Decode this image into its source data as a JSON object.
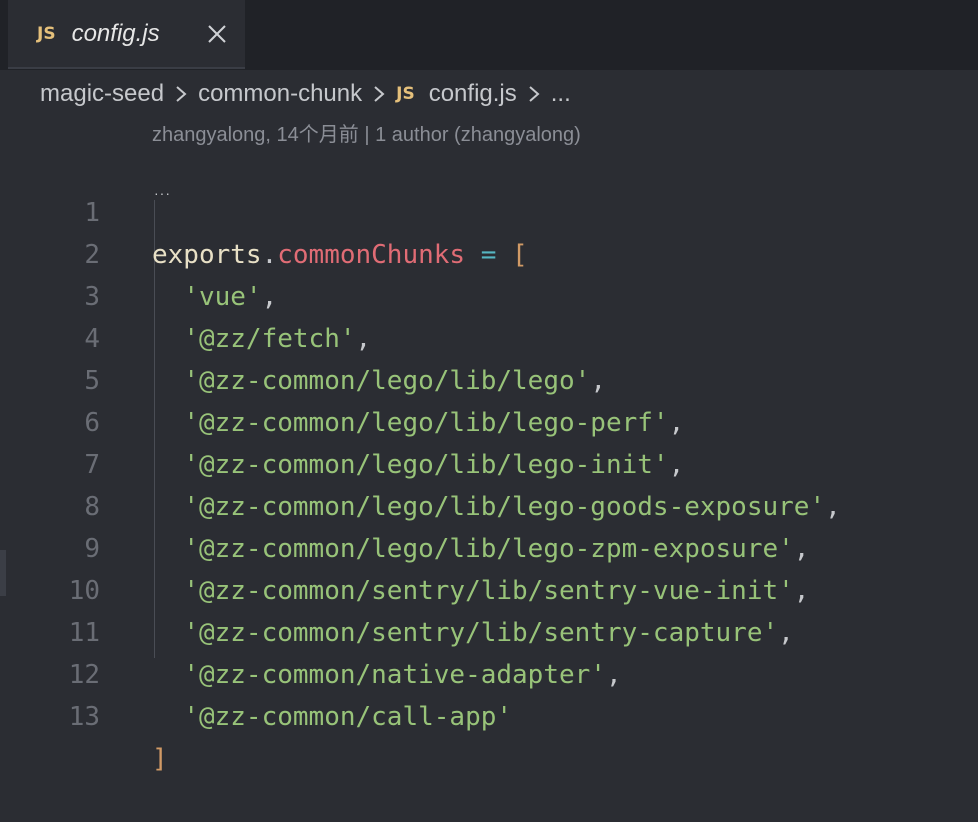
{
  "tab": {
    "badge": "JS",
    "title": "config.js"
  },
  "breadcrumb": {
    "items": [
      "magic-seed",
      "common-chunk"
    ],
    "file_badge": "JS",
    "file": "config.js",
    "more": "..."
  },
  "blame": "zhangyalong, 14个月前 | 1 author (zhangyalong)",
  "editor": {
    "line_numbers": [
      "1",
      "2",
      "3",
      "4",
      "5",
      "6",
      "7",
      "8",
      "9",
      "10",
      "11",
      "12",
      "13"
    ],
    "line1": {
      "obj": "exports",
      "dot": ".",
      "prop": "commonChunks",
      "eq": " = ",
      "open": "["
    },
    "strings": [
      "'vue'",
      "'@zz/fetch'",
      "'@zz-common/lego/lib/lego'",
      "'@zz-common/lego/lib/lego-perf'",
      "'@zz-common/lego/lib/lego-init'",
      "'@zz-common/lego/lib/lego-goods-exposure'",
      "'@zz-common/lego/lib/lego-zpm-exposure'",
      "'@zz-common/sentry/lib/sentry-vue-init'",
      "'@zz-common/sentry/lib/sentry-capture'",
      "'@zz-common/native-adapter'",
      "'@zz-common/call-app'"
    ],
    "comma": ",",
    "close": "]"
  },
  "colors": {
    "background": "#2b2d33",
    "js_badge": "#e5c07b",
    "string": "#98c379",
    "property": "#e06c75",
    "operator": "#56b6c2",
    "bracket": "#d19a66"
  }
}
